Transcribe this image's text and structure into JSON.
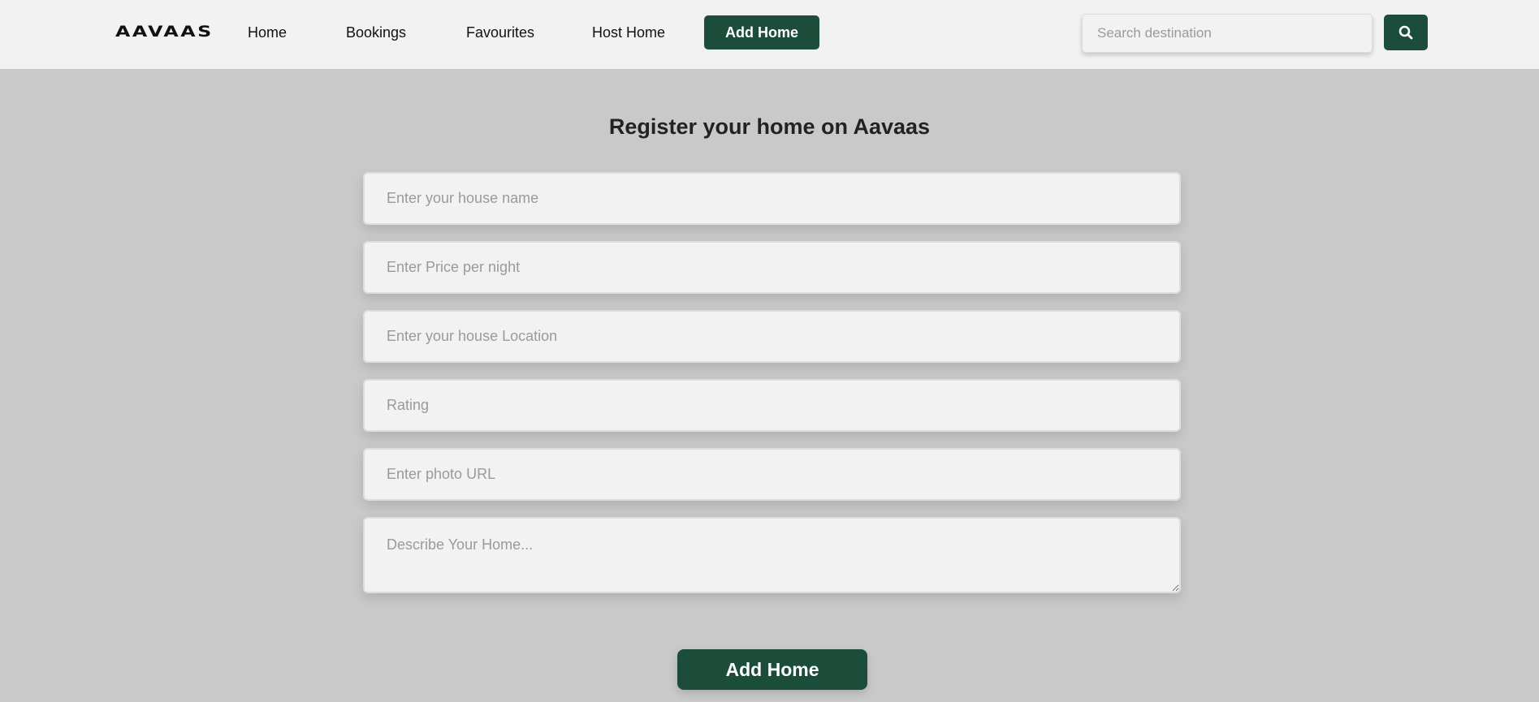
{
  "navbar": {
    "logo": "AAVAAS",
    "links": [
      "Home",
      "Bookings",
      "Favourites",
      "Host Home"
    ],
    "add_home_label": "Add Home",
    "search_placeholder": "Search destination",
    "search_icon": "search-icon"
  },
  "form": {
    "title": "Register your home on Aavaas",
    "fields": {
      "house_name": "Enter your house name",
      "price": "Enter Price per night",
      "location": "Enter your house Location",
      "rating": "Rating",
      "photo_url": "Enter photo URL",
      "description": "Describe Your Home..."
    },
    "submit_label": "Add Home"
  },
  "colors": {
    "accent": "#1b4d3a",
    "background": "#c9c9c9",
    "navbar": "#f2f2f2"
  }
}
